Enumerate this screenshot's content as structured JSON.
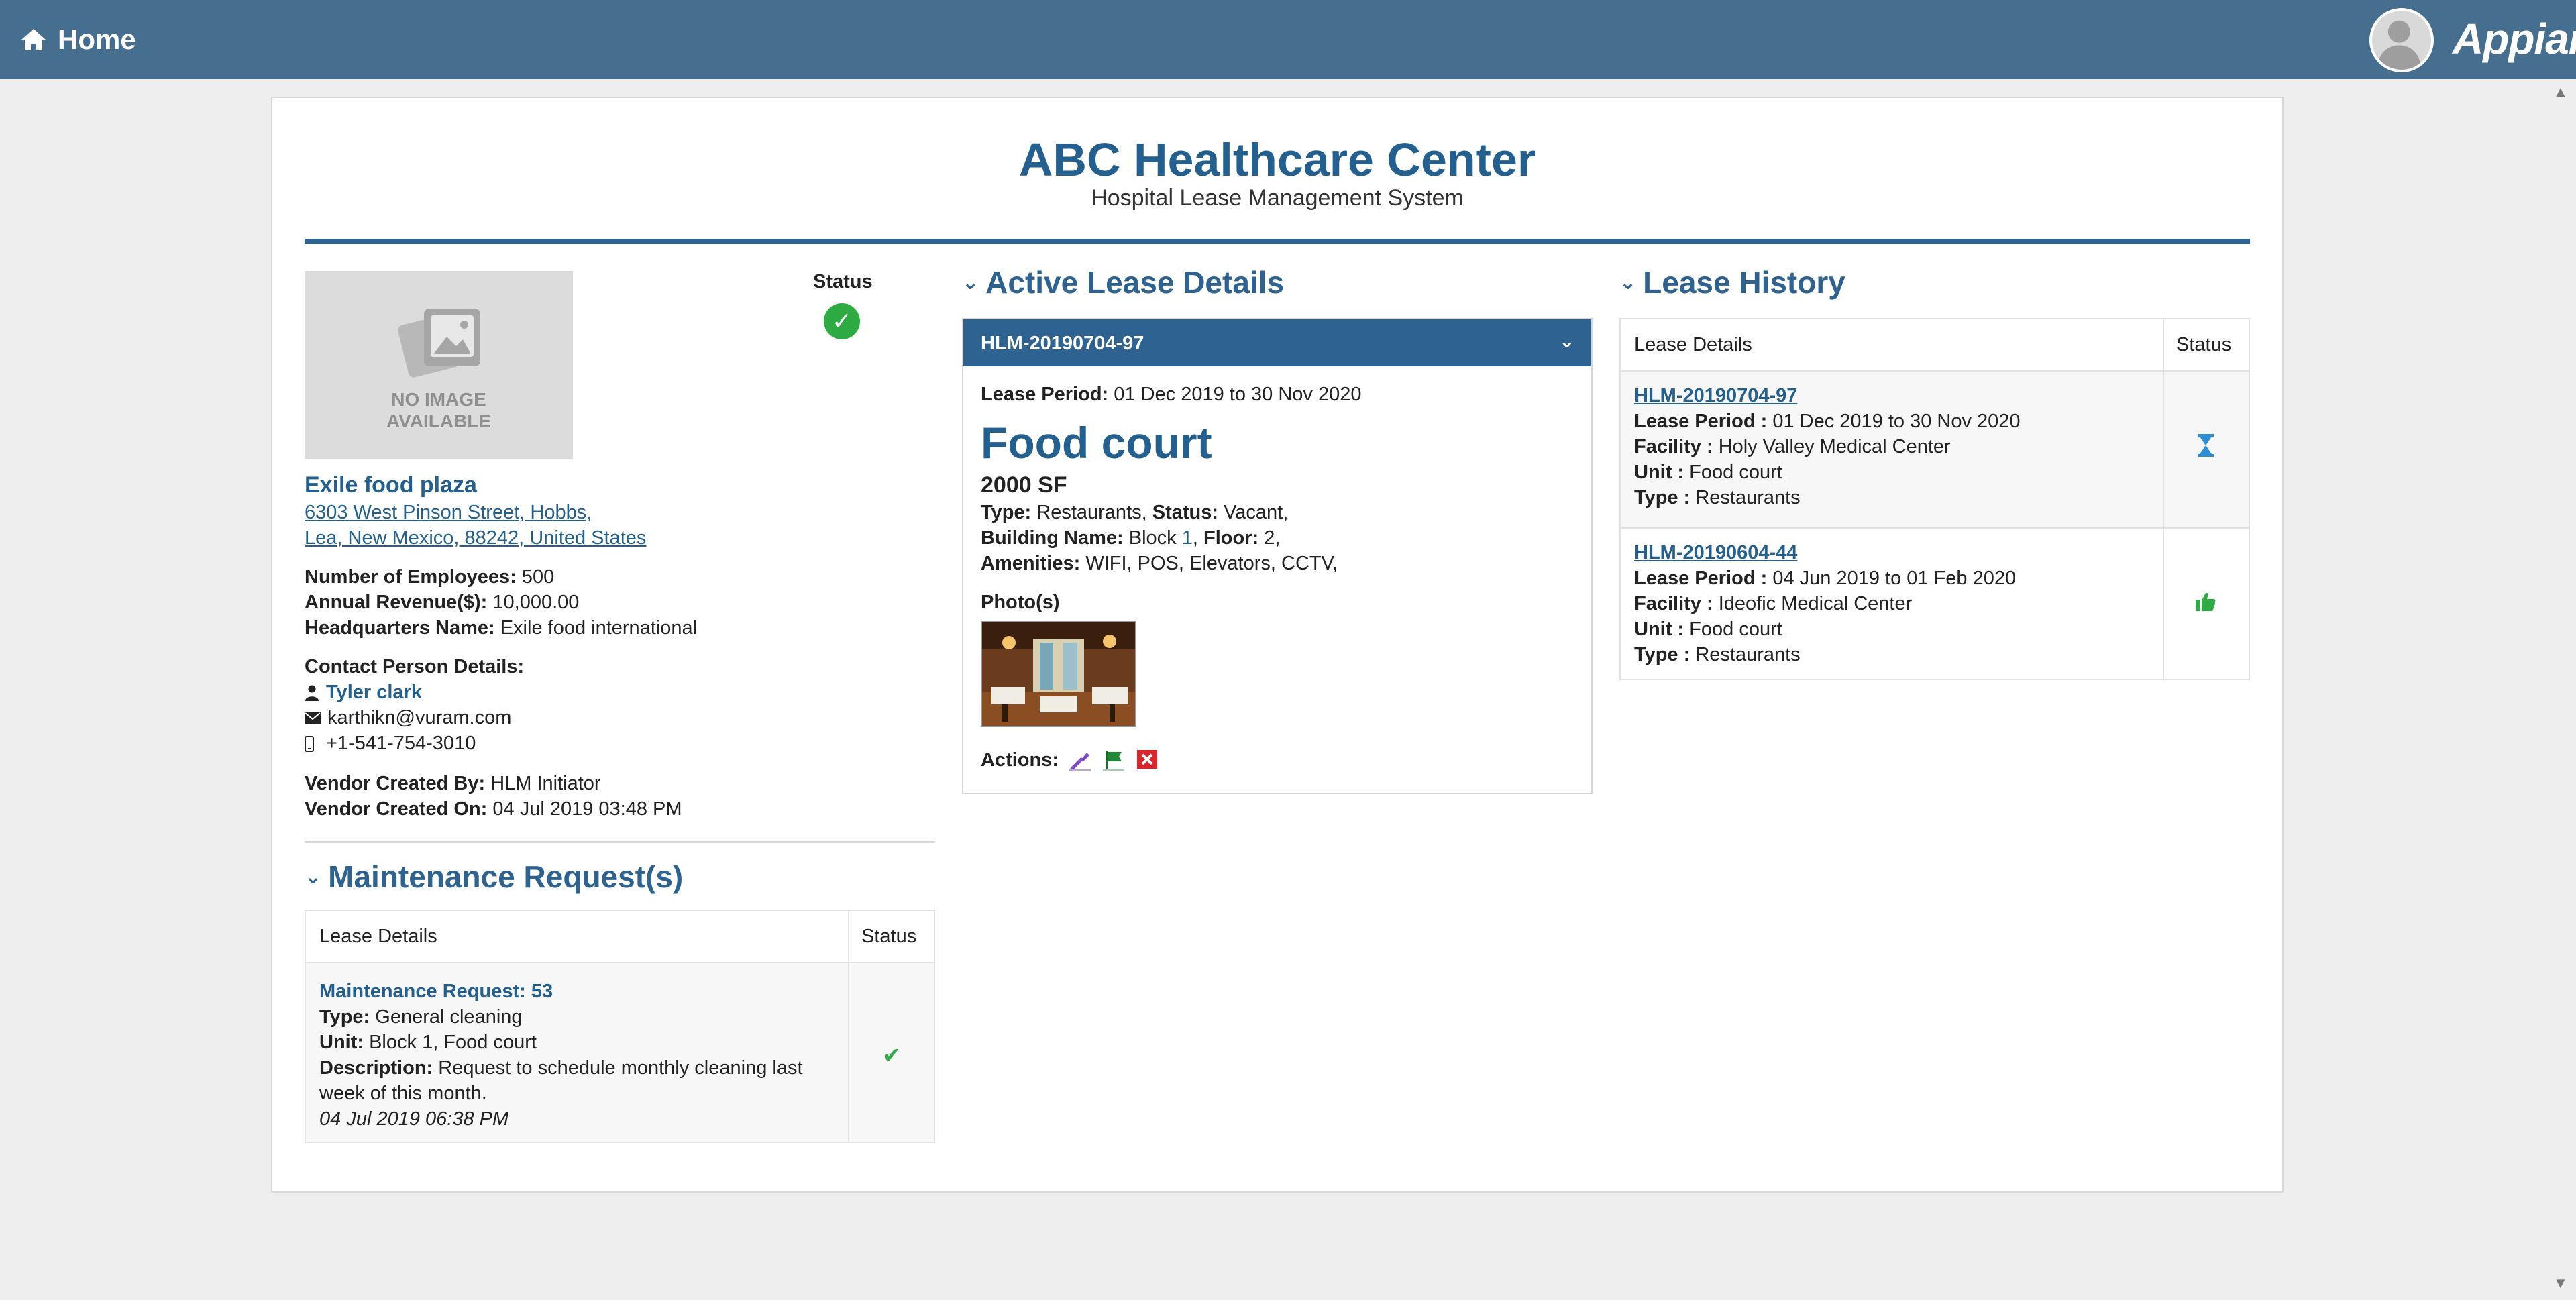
{
  "topbar": {
    "home_label": "Home",
    "brand": "Appian",
    "home_icon": "home-icon"
  },
  "header": {
    "title": "ABC Healthcare Center",
    "subtitle": "Hospital Lease Management System"
  },
  "vendor": {
    "no_image_line1": "NO IMAGE",
    "no_image_line2": "AVAILABLE",
    "status_label": "Status",
    "status_icon": "check-circle-icon",
    "name": "Exile food plaza",
    "address_line1": "6303 West Pinson Street, Hobbs,",
    "address_line2": "Lea, New Mexico, 88242, United States",
    "employees_label": "Number of Employees:",
    "employees": "500",
    "revenue_label": "Annual Revenue($):",
    "revenue": "10,000.00",
    "hq_label": "Headquarters Name:",
    "hq": "Exile food international",
    "contact_label": "Contact Person Details:",
    "contact_name": "Tyler clark",
    "contact_email": "karthikn@vuram.com",
    "contact_phone": "+1-541-754-3010",
    "created_by_label": "Vendor Created By:",
    "created_by": "HLM Initiator",
    "created_on_label": "Vendor Created On:",
    "created_on": "04 Jul 2019 03:48 PM"
  },
  "maintenance": {
    "heading": "Maintenance Request(s)",
    "col_details": "Lease Details",
    "col_status": "Status",
    "rows": [
      {
        "title": "Maintenance Request: 53",
        "type_label": "Type:",
        "type": "General cleaning",
        "unit_label": "Unit:",
        "unit": "Block 1, Food court",
        "desc_label": "Description:",
        "desc_line1": "Request to schedule monthly cleaning last",
        "desc_line2": "week of this month.",
        "timestamp": "04 Jul 2019 06:38 PM",
        "status_icon": "check-icon"
      }
    ]
  },
  "active_lease": {
    "heading": "Active Lease Details",
    "lease_id": "HLM-20190704-97",
    "period_label": "Lease Period:",
    "period": "01 Dec 2019  to 30 Nov 2020",
    "unit_name": "Food court",
    "area": "2000 SF",
    "type_label": "Type:",
    "type": "Restaurants,",
    "status_label": "Status:",
    "status": "Vacant,",
    "building_label": "Building Name:",
    "building": "Block",
    "building_num": "1",
    "floor_label": "Floor:",
    "floor": "2,",
    "amenities_label": "Amenities:",
    "amenities": "WIFI, POS, Elevators, CCTV,",
    "photos_label": "Photo(s)",
    "actions_label": "Actions:",
    "action_icons": [
      "wrench-icon",
      "flag-icon",
      "close-icon"
    ]
  },
  "lease_history": {
    "heading": "Lease History",
    "col_details": "Lease Details",
    "col_status": "Status",
    "rows": [
      {
        "id": "HLM-20190704-97",
        "period_label": "Lease Period :",
        "period": "01 Dec 2019  to 30 Nov 2020",
        "facility_label": "Facility :",
        "facility": "Holy Valley Medical Center",
        "unit_label": "Unit :",
        "unit": "Food court",
        "type_label": "Type :",
        "type": "Restaurants",
        "status_icon": "hourglass-icon"
      },
      {
        "id": "HLM-20190604-44",
        "period_label": "Lease Period :",
        "period": "04 Jun 2019  to 01 Feb 2020",
        "facility_label": "Facility :",
        "facility": "Ideofic Medical Center",
        "unit_label": "Unit :",
        "unit": "Food court",
        "type_label": "Type :",
        "type": "Restaurants",
        "status_icon": "thumbs-up-icon"
      }
    ]
  },
  "colors": {
    "topbar": "#466e8e",
    "accent": "#2e6391",
    "success": "#2eaa43"
  }
}
